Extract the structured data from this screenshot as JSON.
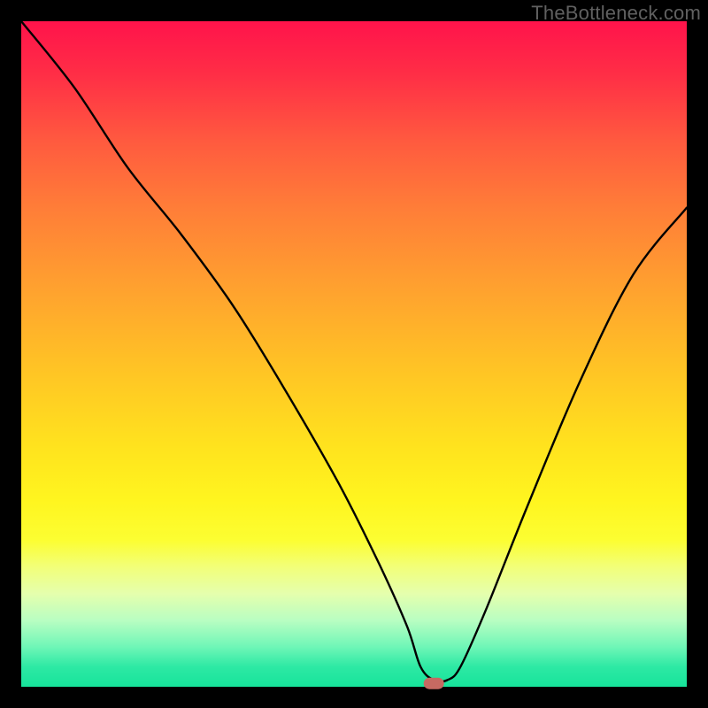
{
  "watermark": "TheBottleneck.com",
  "chart_data": {
    "type": "line",
    "title": "",
    "xlabel": "",
    "ylabel": "",
    "xlim": [
      0,
      100
    ],
    "ylim": [
      0,
      100
    ],
    "series": [
      {
        "name": "bottleneck-curve",
        "x": [
          0,
          8,
          16,
          24,
          32,
          40,
          48,
          54,
          58,
          60,
          62,
          64,
          66,
          70,
          76,
          84,
          92,
          100
        ],
        "values": [
          100,
          90,
          78,
          68,
          57,
          44,
          30,
          18,
          9,
          3,
          1,
          1,
          3,
          12,
          27,
          46,
          62,
          72
        ]
      }
    ],
    "marker": {
      "x": 62,
      "y": 0.5,
      "label": "optimal-point"
    },
    "gradient_stops": [
      {
        "pos": 0,
        "color": "#ff134b"
      },
      {
        "pos": 50,
        "color": "#ffc325"
      },
      {
        "pos": 80,
        "color": "#fcfe32"
      },
      {
        "pos": 100,
        "color": "#17e49b"
      }
    ]
  }
}
